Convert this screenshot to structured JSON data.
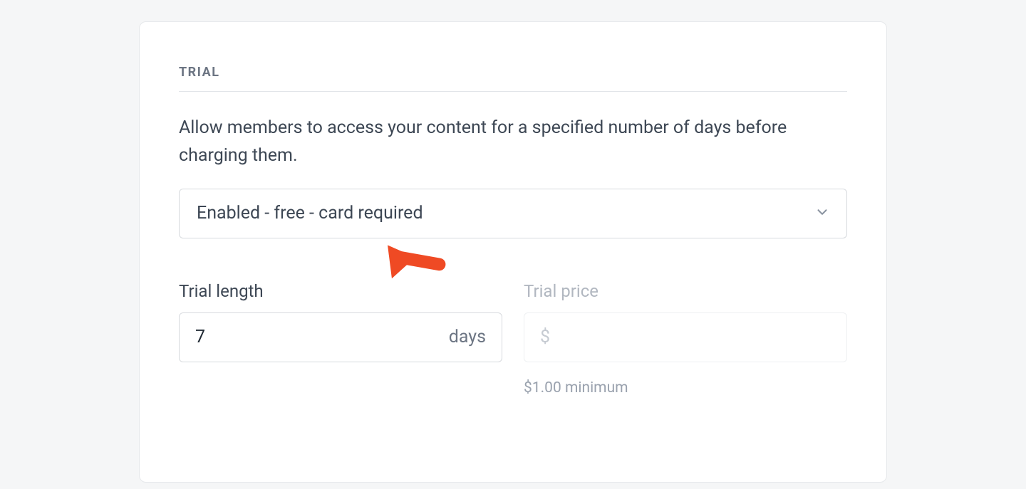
{
  "section": {
    "title": "TRIAL",
    "description": "Allow members to access your content for a specified number of days before charging them."
  },
  "select": {
    "selected_label": "Enabled - free - card required"
  },
  "trial_length": {
    "label": "Trial length",
    "value": "7",
    "unit": "days"
  },
  "trial_price": {
    "label": "Trial price",
    "currency_symbol": "$",
    "value": "",
    "hint": "$1.00 minimum"
  }
}
